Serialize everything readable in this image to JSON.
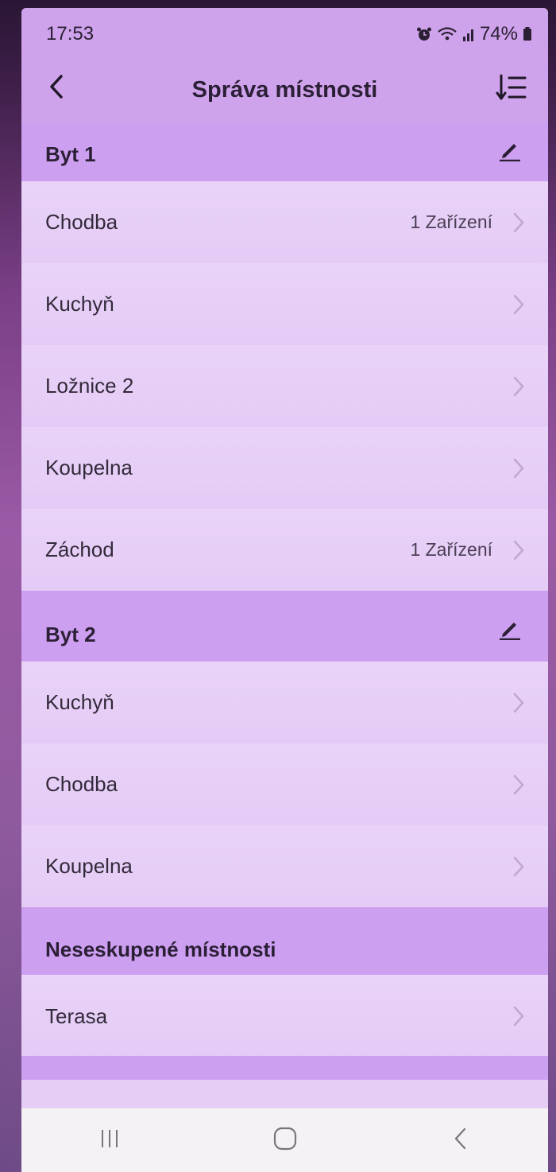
{
  "status_bar": {
    "time": "17:53",
    "battery": "74%",
    "icons": [
      "alarm-icon",
      "wifi-icon",
      "signal-icon",
      "battery-icon"
    ]
  },
  "header": {
    "title": "Správa místnosti",
    "back_icon": "back-arrow-icon",
    "sort_icon": "sort-icon"
  },
  "groups": [
    {
      "label": "Byt 1",
      "editable": true,
      "rooms": [
        {
          "name": "Chodba",
          "devices": "1 Zařízení"
        },
        {
          "name": "Kuchyň",
          "devices": ""
        },
        {
          "name": "Ložnice 2",
          "devices": ""
        },
        {
          "name": "Koupelna",
          "devices": ""
        },
        {
          "name": "Záchod",
          "devices": "1 Zařízení"
        }
      ]
    },
    {
      "label": "Byt 2",
      "editable": true,
      "rooms": [
        {
          "name": "Kuchyň",
          "devices": ""
        },
        {
          "name": "Chodba",
          "devices": ""
        },
        {
          "name": "Koupelna",
          "devices": ""
        }
      ]
    },
    {
      "label": "Neseskupené místnosti",
      "editable": false,
      "rooms": [
        {
          "name": "Terasa",
          "devices": ""
        }
      ]
    }
  ],
  "colors": {
    "header_bg": "#cfa3ec",
    "section_bg": "#cd9ff0",
    "row_bg": "#e6cdf6",
    "nav_bg": "#f4f2f5"
  },
  "nav_bar": {
    "icons": [
      "recent-apps-icon",
      "home-icon",
      "nav-back-icon"
    ]
  }
}
